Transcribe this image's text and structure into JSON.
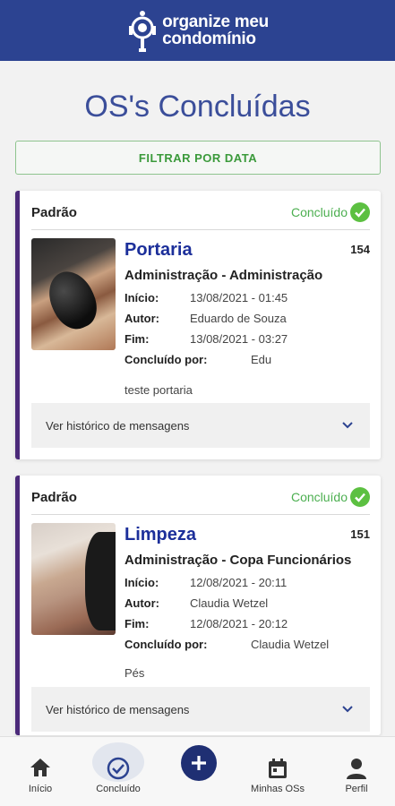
{
  "header": {
    "logo_line1": "organize meu",
    "logo_line2": "condomínio"
  },
  "page": {
    "title": "OS's Concluídas",
    "filter_label": "FILTRAR POR DATA"
  },
  "colors": {
    "header_bg": "#2c4391",
    "accent": "#3b4e9a",
    "status_green": "#4caf50",
    "card_border": "#4b2a7a"
  },
  "cards": [
    {
      "type": "Padrão",
      "status": "Concluído",
      "title": "Portaria",
      "number": "154",
      "department": "Administração - Administração",
      "start_label": "Início:",
      "start_value": "13/08/2021 - 01:45",
      "author_label": "Autor:",
      "author_value": "Eduardo de Souza",
      "end_label": "Fim:",
      "end_value": "13/08/2021 - 03:27",
      "done_by_label": "Concluído por:",
      "done_by_value": "Edu",
      "note": "teste portaria",
      "history_label": "Ver histórico de mensagens"
    },
    {
      "type": "Padrão",
      "status": "Concluído",
      "title": "Limpeza",
      "number": "151",
      "department": "Administração - Copa Funcionários",
      "start_label": "Início:",
      "start_value": "12/08/2021 - 20:11",
      "author_label": "Autor:",
      "author_value": "Claudia Wetzel",
      "end_label": "Fim:",
      "end_value": "12/08/2021 - 20:12",
      "done_by_label": "Concluído por:",
      "done_by_value": "Claudia Wetzel",
      "note": "Pés",
      "history_label": "Ver histórico de mensagens"
    }
  ],
  "nav": [
    {
      "label": "Início",
      "icon": "home-icon"
    },
    {
      "label": "Concluído",
      "icon": "check-circle-icon",
      "active": true
    },
    {
      "label": "",
      "icon": "plus-icon"
    },
    {
      "label": "Minhas OSs",
      "icon": "calendar-icon"
    },
    {
      "label": "Perfil",
      "icon": "person-icon"
    }
  ]
}
